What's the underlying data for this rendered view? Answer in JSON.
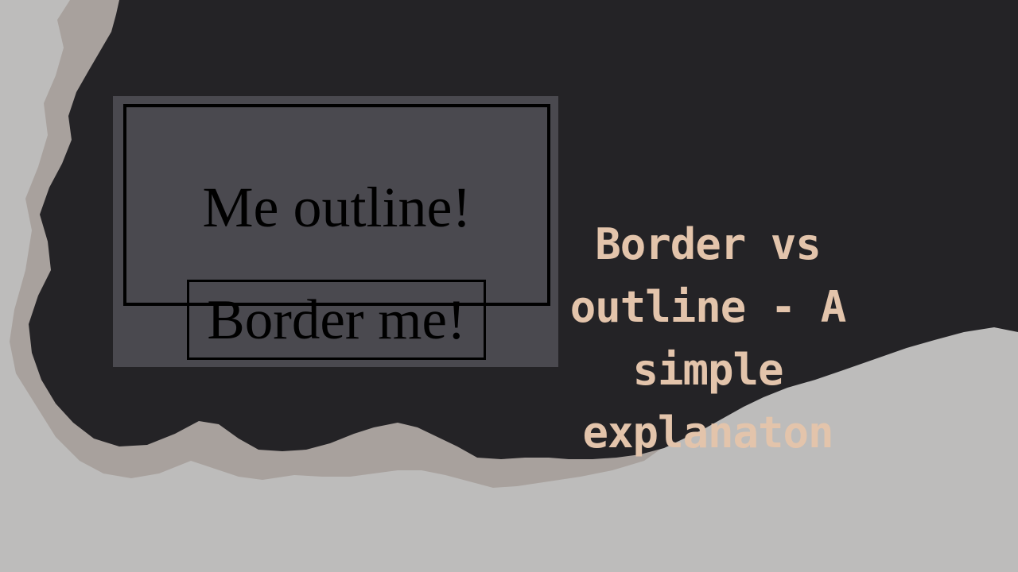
{
  "demo": {
    "outline_label": "Me outline!",
    "border_label": "Border me!"
  },
  "title_lines": [
    "Border vs",
    "outline - A",
    "simple",
    "explanaton"
  ],
  "colors": {
    "dark_backdrop": "#242326",
    "brush_edge": "#a8a19d",
    "light_background": "#bdbcbb",
    "panel": "#4a494f",
    "title_text": "#e3c4ab",
    "box_border": "#000000"
  }
}
